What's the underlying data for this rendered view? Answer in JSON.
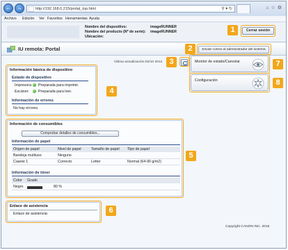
{
  "browser": {
    "url": "http://192.168.0.215/portal_top.html",
    "menu": [
      "Archivo",
      "Edición",
      "Ver",
      "Favoritos",
      "Herramientas",
      "Ayuda"
    ],
    "back_icon": "back-arrow-icon",
    "forward_icon": "forward-arrow-icon"
  },
  "header": {
    "device_name_label": "Nombre del dispositivo:",
    "product_name_label": "Nombre del producto (Nº de serie):",
    "location_label": "Ubicación:",
    "device_name_value": "imageRUNNER",
    "product_name_value": "imageRUNNER",
    "logout_label": "Cerrar sesión"
  },
  "portal": {
    "title": "IU remota: Portal",
    "mail_admin_label": "Enviar correo al administrador del sistema",
    "last_updated": "Última actualización:02/10 2012"
  },
  "basic_info": {
    "title": "Información básica de dispositivo",
    "status_title": "Estado de dispositivo",
    "printer_label": "Impresora:",
    "printer_status": "Preparada para imprimir.",
    "scanner_label": "Escáner:",
    "scanner_status": "Preparada para leer.",
    "errors_title": "Información de errores",
    "errors_value": "No hay errores."
  },
  "side_buttons": {
    "monitor_label": "Monitor de estado/Cancelar",
    "settings_label": "Configuración"
  },
  "consumables": {
    "title": "Información de consumibles",
    "check_button": "Comprobar detalles de consumibles...",
    "paper_title": "Información de papel",
    "paper_headers": [
      "Origen de papel",
      "Nivel de papel",
      "Tamaño de papel",
      "Tipo de papel"
    ],
    "paper_rows": [
      [
        "Bandeja multiuso",
        "Ninguno",
        "",
        ""
      ],
      [
        "Casete 1",
        "Correcto",
        "Letter",
        "Normal (64-90 g/m2)"
      ]
    ],
    "toner_title": "Información de tóner",
    "toner_headers": [
      "Color",
      "Grado"
    ],
    "toner_rows": [
      {
        "color": "Negro",
        "level_text": "80 %",
        "level": 0.8
      }
    ]
  },
  "support": {
    "title": "Enlace de asistencia",
    "link_text": "Enlace de asistencia:"
  },
  "footer": {
    "copyright": "Copyright CANON INC. 2016"
  },
  "annotations": {
    "n1": "1",
    "n2": "2",
    "n3": "3",
    "n4": "4",
    "n5": "5",
    "n6": "6",
    "n7": "7",
    "n8": "8"
  },
  "colors": {
    "accent": "#f2a71b",
    "status_ok": "#2f9a1f"
  }
}
